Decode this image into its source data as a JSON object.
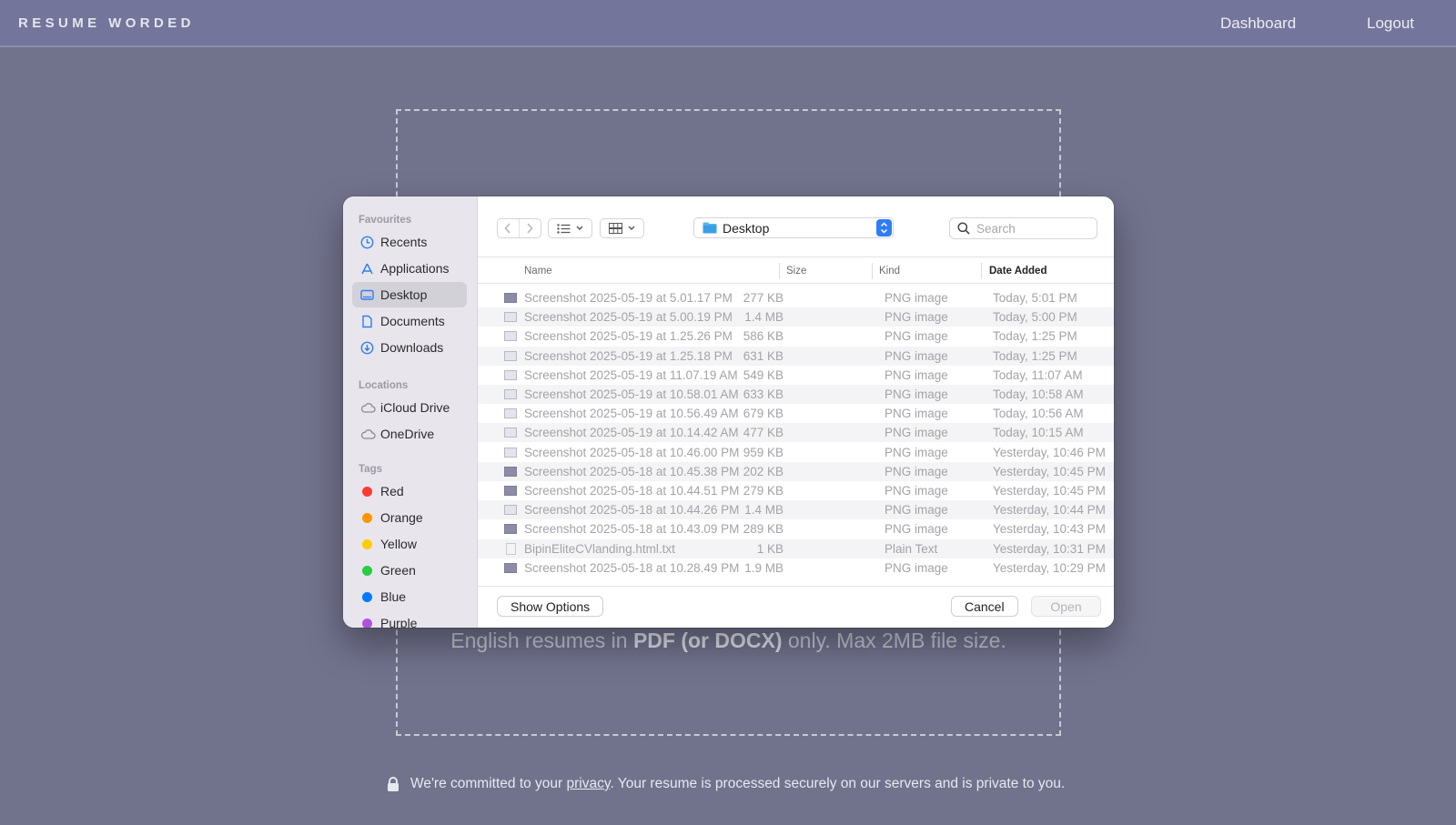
{
  "site": {
    "logo": "RESUME WORDED",
    "nav": {
      "dashboard": "Dashboard",
      "logout": "Logout"
    }
  },
  "dropzone": {
    "text_pre": "English resumes in ",
    "text_bold": "PDF (or DOCX)",
    "text_post": " only. Max 2MB file size."
  },
  "privacy": {
    "pre": "We're committed to your ",
    "link": "privacy",
    "post": ". Your resume is processed securely on our servers and is private to you."
  },
  "dialog": {
    "sidebar": {
      "favourites_label": "Favourites",
      "favourites": [
        {
          "label": "Recents",
          "icon": "clock-icon"
        },
        {
          "label": "Applications",
          "icon": "applications-icon"
        },
        {
          "label": "Desktop",
          "icon": "desktop-icon",
          "selected": true
        },
        {
          "label": "Documents",
          "icon": "document-icon"
        },
        {
          "label": "Downloads",
          "icon": "download-icon"
        }
      ],
      "locations_label": "Locations",
      "locations": [
        {
          "label": "iCloud Drive",
          "icon": "cloud-icon"
        },
        {
          "label": "OneDrive",
          "icon": "cloud-icon"
        }
      ],
      "tags_label": "Tags",
      "tags": [
        {
          "label": "Red",
          "color": "#ff3b30"
        },
        {
          "label": "Orange",
          "color": "#ff9500"
        },
        {
          "label": "Yellow",
          "color": "#ffcc00"
        },
        {
          "label": "Green",
          "color": "#28cd41"
        },
        {
          "label": "Blue",
          "color": "#007aff"
        },
        {
          "label": "Purple",
          "color": "#af52de"
        }
      ]
    },
    "toolbar": {
      "location": "Desktop",
      "search_placeholder": "Search"
    },
    "columns": {
      "name": "Name",
      "size": "Size",
      "kind": "Kind",
      "date": "Date Added"
    },
    "files": [
      {
        "name": "Screenshot 2025-05-19 at 5.01.17 PM",
        "size": "277 KB",
        "kind": "PNG image",
        "date": "Today, 5:01 PM",
        "thumb": "dark"
      },
      {
        "name": "Screenshot 2025-05-19 at 5.00.19 PM",
        "size": "1.4 MB",
        "kind": "PNG image",
        "date": "Today, 5:00 PM",
        "thumb": "light"
      },
      {
        "name": "Screenshot 2025-05-19 at 1.25.26 PM",
        "size": "586 KB",
        "kind": "PNG image",
        "date": "Today, 1:25 PM",
        "thumb": "light"
      },
      {
        "name": "Screenshot 2025-05-19 at 1.25.18 PM",
        "size": "631 KB",
        "kind": "PNG image",
        "date": "Today, 1:25 PM",
        "thumb": "light"
      },
      {
        "name": "Screenshot 2025-05-19 at 11.07.19 AM",
        "size": "549 KB",
        "kind": "PNG image",
        "date": "Today, 11:07 AM",
        "thumb": "light"
      },
      {
        "name": "Screenshot 2025-05-19 at 10.58.01 AM",
        "size": "633 KB",
        "kind": "PNG image",
        "date": "Today, 10:58 AM",
        "thumb": "light"
      },
      {
        "name": "Screenshot 2025-05-19 at 10.56.49 AM",
        "size": "679 KB",
        "kind": "PNG image",
        "date": "Today, 10:56 AM",
        "thumb": "light"
      },
      {
        "name": "Screenshot 2025-05-19 at 10.14.42 AM",
        "size": "477 KB",
        "kind": "PNG image",
        "date": "Today, 10:15 AM",
        "thumb": "light"
      },
      {
        "name": "Screenshot 2025-05-18 at 10.46.00 PM",
        "size": "959 KB",
        "kind": "PNG image",
        "date": "Yesterday, 10:46 PM",
        "thumb": "light"
      },
      {
        "name": "Screenshot 2025-05-18 at 10.45.38 PM",
        "size": "202 KB",
        "kind": "PNG image",
        "date": "Yesterday, 10:45 PM",
        "thumb": "dark"
      },
      {
        "name": "Screenshot 2025-05-18 at 10.44.51 PM",
        "size": "279 KB",
        "kind": "PNG image",
        "date": "Yesterday, 10:45 PM",
        "thumb": "dark"
      },
      {
        "name": "Screenshot 2025-05-18 at 10.44.26 PM",
        "size": "1.4 MB",
        "kind": "PNG image",
        "date": "Yesterday, 10:44 PM",
        "thumb": "light"
      },
      {
        "name": "Screenshot 2025-05-18 at 10.43.09 PM",
        "size": "289 KB",
        "kind": "PNG image",
        "date": "Yesterday, 10:43 PM",
        "thumb": "dark"
      },
      {
        "name": "BipinEliteCVlanding.html.txt",
        "size": "1 KB",
        "kind": "Plain Text",
        "date": "Yesterday, 10:31 PM",
        "thumb": "doc"
      },
      {
        "name": "Screenshot 2025-05-18 at 10.28.49 PM",
        "size": "1.9 MB",
        "kind": "PNG image",
        "date": "Yesterday, 10:29 PM",
        "thumb": "dark"
      }
    ],
    "footer": {
      "show_options": "Show Options",
      "cancel": "Cancel",
      "open": "Open"
    }
  }
}
